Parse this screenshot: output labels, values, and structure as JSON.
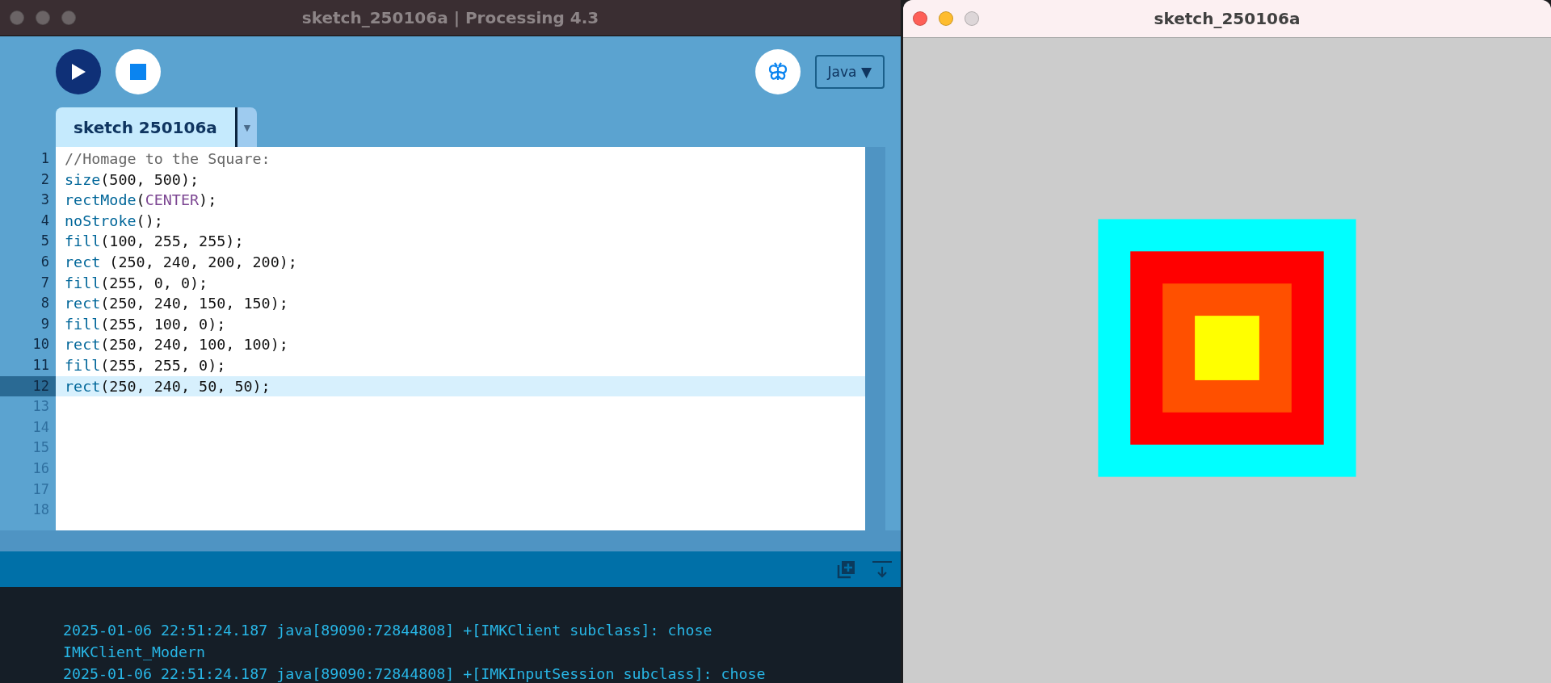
{
  "editor_window": {
    "title": "sketch_250106a | Processing 4.3",
    "mode": "Java ▼",
    "tab": {
      "label": "sketch 250106a",
      "selected": true
    },
    "tab_menu": "▼",
    "lines": [
      {
        "number": "1",
        "selected": false,
        "tokens": [
          {
            "kind": "comment",
            "text": "//Homage to the Square:"
          }
        ]
      },
      {
        "number": "2",
        "selected": false,
        "tokens": [
          {
            "kind": "function",
            "text": "size"
          },
          {
            "kind": "plain",
            "text": "(500, 500);"
          }
        ]
      },
      {
        "number": "3",
        "selected": false,
        "tokens": [
          {
            "kind": "function",
            "text": "rectMode"
          },
          {
            "kind": "plain",
            "text": "("
          },
          {
            "kind": "constant",
            "text": "CENTER"
          },
          {
            "kind": "plain",
            "text": ");"
          }
        ]
      },
      {
        "number": "4",
        "selected": false,
        "tokens": [
          {
            "kind": "function",
            "text": "noStroke"
          },
          {
            "kind": "plain",
            "text": "();"
          }
        ]
      },
      {
        "number": "5",
        "selected": false,
        "tokens": [
          {
            "kind": "function",
            "text": "fill"
          },
          {
            "kind": "plain",
            "text": "(100, 255, 255);"
          }
        ]
      },
      {
        "number": "6",
        "selected": false,
        "tokens": [
          {
            "kind": "function",
            "text": "rect"
          },
          {
            "kind": "plain",
            "text": " (250, 240, 200, 200);"
          }
        ]
      },
      {
        "number": "7",
        "selected": false,
        "tokens": [
          {
            "kind": "function",
            "text": "fill"
          },
          {
            "kind": "plain",
            "text": "(255, 0, 0);"
          }
        ]
      },
      {
        "number": "8",
        "selected": false,
        "tokens": [
          {
            "kind": "function",
            "text": "rect"
          },
          {
            "kind": "plain",
            "text": "(250, 240, 150, 150);"
          }
        ]
      },
      {
        "number": "9",
        "selected": false,
        "tokens": [
          {
            "kind": "function",
            "text": "fill"
          },
          {
            "kind": "plain",
            "text": "(255, 100, 0);"
          }
        ]
      },
      {
        "number": "10",
        "selected": false,
        "tokens": [
          {
            "kind": "function",
            "text": "rect"
          },
          {
            "kind": "plain",
            "text": "(250, 240, 100, 100);"
          }
        ]
      },
      {
        "number": "11",
        "selected": false,
        "tokens": [
          {
            "kind": "function",
            "text": "fill"
          },
          {
            "kind": "plain",
            "text": "(255, 255, 0);"
          }
        ]
      },
      {
        "number": "12",
        "selected": true,
        "tokens": [
          {
            "kind": "function",
            "text": "rect"
          },
          {
            "kind": "plain",
            "text": "(250, 240, 50, 50);"
          }
        ]
      },
      {
        "number": "13",
        "selected": false
      },
      {
        "number": "14",
        "selected": false
      },
      {
        "number": "15",
        "selected": false
      },
      {
        "number": "16",
        "selected": false
      },
      {
        "number": "17",
        "selected": false
      },
      {
        "number": "18",
        "selected": false
      }
    ],
    "console": [
      "2025-01-06 22:51:24.187 java[89090:72844808] +[IMKClient subclass]: chose",
      "IMKClient_Modern",
      "2025-01-06 22:51:24.187 java[89090:72844808] +[IMKInputSession subclass]: chose"
    ]
  },
  "sketch_window": {
    "title": "sketch_250106a",
    "squares": [
      {
        "color": "#00ffff"
      },
      {
        "color": "#ff0000"
      },
      {
        "color": "#ff5000"
      },
      {
        "color": "#ffff00"
      }
    ]
  }
}
